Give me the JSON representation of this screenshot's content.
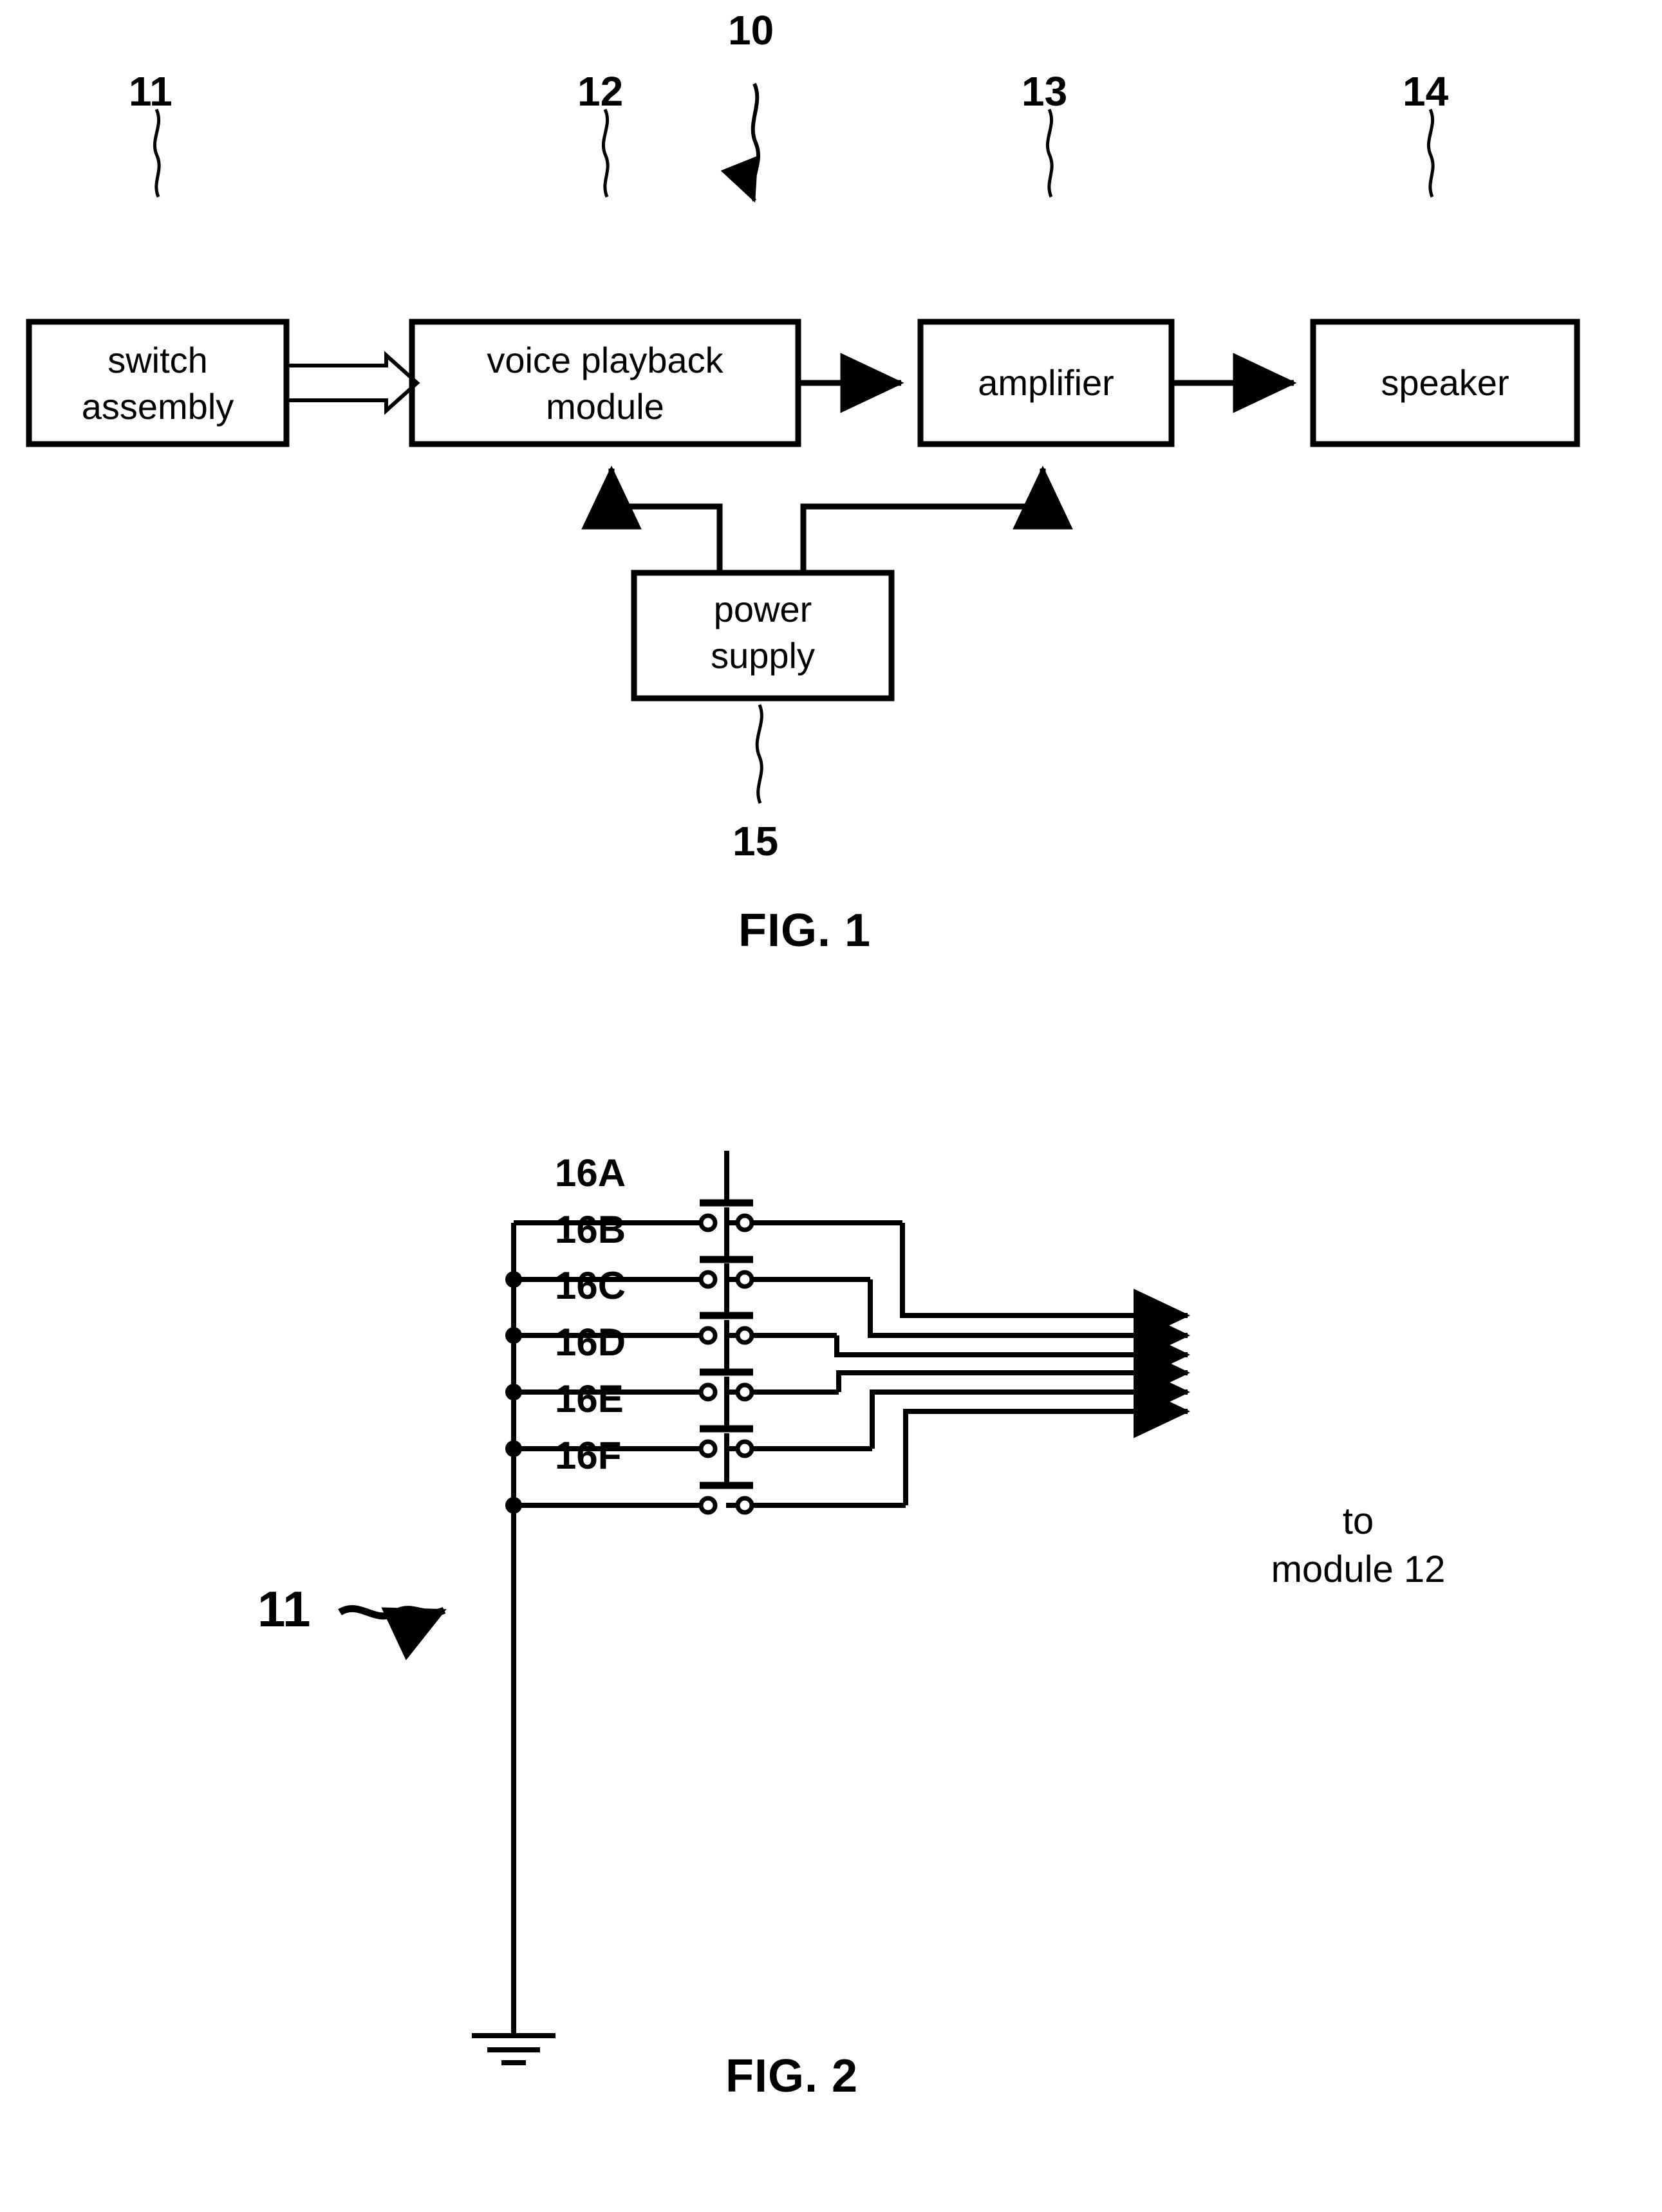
{
  "document": {
    "kind": "patent-drawing-sheet",
    "figures": [
      "FIG. 1",
      "FIG. 2"
    ]
  },
  "fig1": {
    "caption": "FIG. 1",
    "system_ref": "10",
    "blocks": [
      {
        "id": "switch-assembly",
        "label_line1": "switch",
        "label_line2": "assembly",
        "ref": "11"
      },
      {
        "id": "voice-playback",
        "label_line1": "voice playback",
        "label_line2": "module",
        "ref": "12"
      },
      {
        "id": "amplifier",
        "label_line1": "amplifier",
        "label_line2": "",
        "ref": "13"
      },
      {
        "id": "speaker",
        "label_line1": "speaker",
        "label_line2": "",
        "ref": "14"
      },
      {
        "id": "power-supply",
        "label_line1": "power",
        "label_line2": "supply",
        "ref": "15"
      }
    ],
    "connections": [
      {
        "from": "switch-assembly",
        "to": "voice-playback",
        "style": "hollow-arrow"
      },
      {
        "from": "voice-playback",
        "to": "amplifier",
        "style": "solid-arrow"
      },
      {
        "from": "amplifier",
        "to": "speaker",
        "style": "solid-arrow"
      },
      {
        "from": "power-supply",
        "to": "voice-playback",
        "style": "solid-arrow"
      },
      {
        "from": "power-supply",
        "to": "amplifier",
        "style": "solid-arrow"
      }
    ]
  },
  "fig2": {
    "caption": "FIG. 2",
    "assembly_ref": "11",
    "destination_line1": "to",
    "destination_line2": "module 12",
    "switches": [
      {
        "ref": "16A"
      },
      {
        "ref": "16B"
      },
      {
        "ref": "16C"
      },
      {
        "ref": "16D"
      },
      {
        "ref": "16E"
      },
      {
        "ref": "16F"
      }
    ],
    "ground": "earth-ground",
    "output_count": 6
  },
  "style": {
    "ink": "#000000",
    "paper": "#ffffff"
  }
}
